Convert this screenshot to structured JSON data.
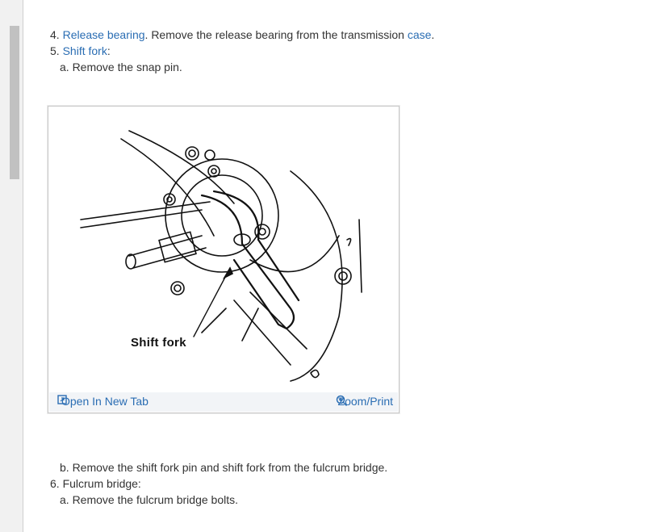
{
  "steps_top": {
    "step4_num": "4.",
    "step4_link": "Release bearing",
    "step4_mid": ". Remove the release bearing from the transmission ",
    "step4_link2": "case",
    "step4_end": ".",
    "step5_num": "5.",
    "step5_link": "Shift fork",
    "step5_end": ":",
    "step5a": "a. Remove the snap pin."
  },
  "figure": {
    "caption": "Shift fork",
    "open_label": "Open In New Tab",
    "zoom_label": "Zoom/Print"
  },
  "steps_bottom": {
    "step5b": "b. Remove the shift fork pin and shift fork from the fulcrum bridge.",
    "step6": "6. Fulcrum bridge:",
    "step6a": "a. Remove the fulcrum bridge bolts."
  },
  "colors": {
    "link": "#2a6db3",
    "text": "#333333",
    "bar": "#f2f4f7"
  }
}
